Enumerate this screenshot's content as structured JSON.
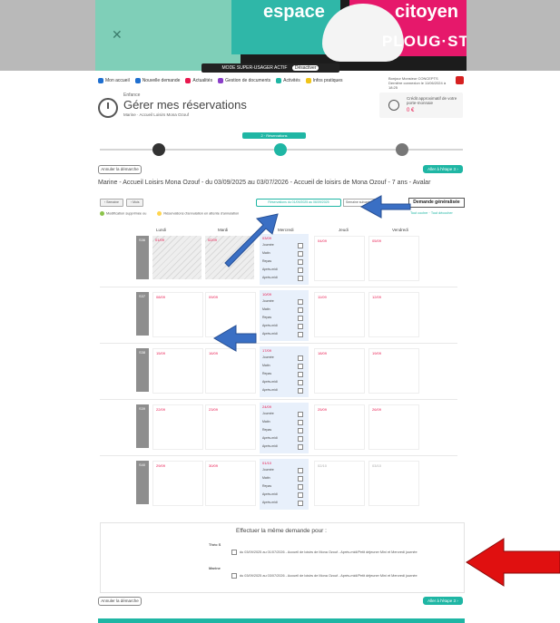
{
  "banner": {
    "left_word": "espace",
    "right_word": "citoyen",
    "city": "PLOUG·STEL",
    "mode_text": "MODE SUPER-USAGER ACTIF",
    "mode_button": "Désactiver"
  },
  "nav": {
    "items": [
      {
        "label": "Mon accueil",
        "icon": "home-icon",
        "color": "#1f6fd0"
      },
      {
        "label": "Nouvelle demande",
        "icon": "plus-icon",
        "color": "#1f6fd0"
      },
      {
        "label": "Actualités",
        "icon": "news-icon",
        "color": "#e8184e"
      },
      {
        "label": "Gestion de documents",
        "icon": "document-icon",
        "color": "#8a3ec8"
      },
      {
        "label": "Activités",
        "icon": "activity-icon",
        "color": "#1fb6a4"
      },
      {
        "label": "Infos pratiques",
        "icon": "info-icon",
        "color": "#f0c419"
      }
    ],
    "user_line1": "Bonjour Monsieur CONCEPTS",
    "user_line2": "Dernière connexion le 11/06/2024 à 18:25"
  },
  "header": {
    "crumb": "Enfance",
    "title": "Gérer mes réservations",
    "subtitle": "Marine · Accueil Loisirs Mona Ozouf",
    "balance_label": "Crédit approximatif de votre porte-monnaie",
    "balance_value": "0 €"
  },
  "steps": {
    "current_label": "2 · Réservations",
    "icons": [
      "info-icon",
      "pencil-icon",
      "document-icon"
    ]
  },
  "actions": {
    "back": "Annuler la démarche",
    "next": "Aller à l'étape 3 ›"
  },
  "activity": {
    "title": "Marine - Accueil Loisirs Mona Ozouf - du 03/09/2025 au 03/07/2026 - Accueil de loisirs de Mona Ozouf - 7 ans - Avalar",
    "prev_week": "‹ Semaine",
    "prev_month": "‹ Mois",
    "week_range": "Réservations du 01/09/2025 au 06/09/2025",
    "next_week": "Semaine suivante ›",
    "generalize": "Demande généralisée"
  },
  "legend": {
    "item1": "Modification supprimée ou",
    "item1_color": "#8bc34a",
    "item2": "Réservations d'annulation en attente d'annulation",
    "item2_color": "#ffd54f",
    "right": "Tout cocher · Tout décocher"
  },
  "days": [
    "Lundi",
    "Mardi",
    "Mercredi",
    "Jeudi",
    "Vendredi"
  ],
  "weeks": [
    {
      "label": "S36",
      "mon": "01/09",
      "tue": "02/09",
      "wed": "03/09",
      "thu": "04/09",
      "fri": "05/09"
    },
    {
      "label": "S37",
      "mon": "08/09",
      "tue": "09/09",
      "wed": "10/09",
      "thu": "11/09",
      "fri": "12/09"
    },
    {
      "label": "S38",
      "mon": "15/09",
      "tue": "16/09",
      "wed": "17/09",
      "thu": "18/09",
      "fri": "19/09"
    },
    {
      "label": "S39",
      "mon": "22/09",
      "tue": "23/09",
      "wed": "24/09",
      "thu": "25/09",
      "fri": "26/09"
    },
    {
      "label": "S40",
      "mon": "29/09",
      "tue": "30/09",
      "wed": "01/10",
      "thu": "02/10",
      "fri": "03/10"
    }
  ],
  "wed_options": [
    "Journée",
    "Matin",
    "Repas",
    "Après-midi",
    "Après-midi"
  ],
  "repeat": {
    "title": "Effectuer la même demande pour :",
    "child1": "Théo S",
    "child1_line": "du 03/09/2025 au 01/07/2026 - Accueil de loisirs de Mona Ozouf - Après-midi/Petit déjeuner Mini et Mercredi journée",
    "child2": "Marine",
    "child2_line": "du 03/09/2025 au 03/07/2026 - Accueil de loisirs de Mona Ozouf - Après-midi/Petit déjeuner Mini et Mercredi journée"
  }
}
